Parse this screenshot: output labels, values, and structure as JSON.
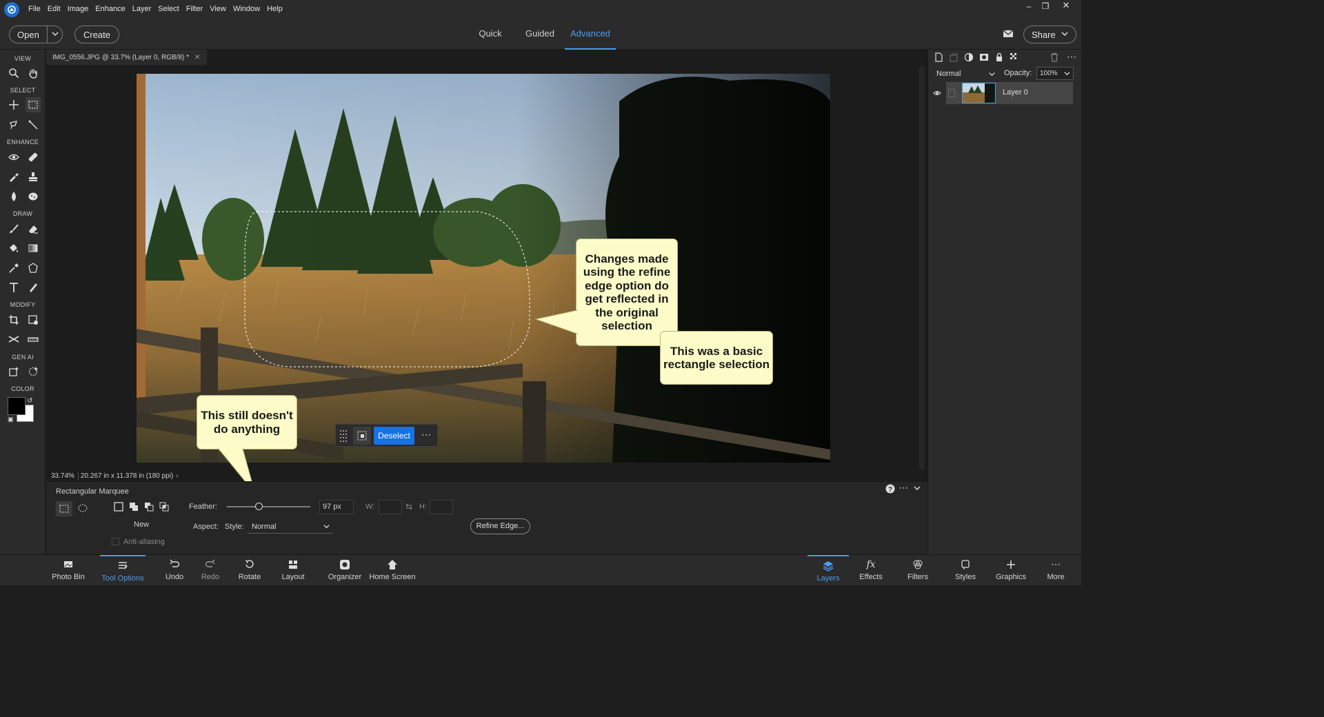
{
  "menubar": {
    "items": [
      "File",
      "Edit",
      "Image",
      "Enhance",
      "Layer",
      "Select",
      "Filter",
      "View",
      "Window",
      "Help"
    ]
  },
  "topbar": {
    "open_label": "Open",
    "create_label": "Create",
    "modes": [
      "Quick",
      "Guided",
      "Advanced"
    ],
    "active_mode": "Advanced",
    "share_label": "Share"
  },
  "toolbar": {
    "sections": [
      "VIEW",
      "SELECT",
      "ENHANCE",
      "DRAW",
      "MODIFY",
      "GEN AI",
      "COLOR"
    ]
  },
  "document": {
    "tab_title": "IMG_0556.JPG @ 33.7% (Layer 0, RGB/8) *",
    "zoom": "33.74%",
    "dimensions": "20.267 in x 11.378 in (180 ppi)"
  },
  "callouts": {
    "refine": "Changes made using the refine edge option do get reflected in the original selection",
    "basic": "This was a basic rectangle selection",
    "nothing": "This still doesn't do anything"
  },
  "selection_bar": {
    "deselect_label": "Deselect"
  },
  "tool_options": {
    "tool_name": "Rectangular Marquee",
    "new_label": "New",
    "feather_label": "Feather:",
    "feather_value": "97 px",
    "feather_fraction": 0.38,
    "w_label": "W:",
    "h_label": "H:",
    "aspect_label": "Aspect:",
    "style_label": "Style:",
    "style_value": "Normal",
    "anti_alias_label": "Anti-aliasing",
    "refine_edge_label": "Refine Edge..."
  },
  "layers_panel": {
    "blend_mode": "Normal",
    "opacity_label": "Opacity:",
    "opacity_value": "100%",
    "layers": [
      "Layer 0"
    ]
  },
  "taskbar": {
    "left": [
      "Photo Bin",
      "Tool Options",
      "Undo",
      "Redo",
      "Rotate",
      "Layout",
      "Organizer",
      "Home Screen"
    ],
    "right": [
      "Layers",
      "Effects",
      "Filters",
      "Styles",
      "Graphics",
      "More"
    ]
  },
  "colors": {
    "accent": "#1473e6",
    "callout_bg": "#fdfcc8"
  }
}
